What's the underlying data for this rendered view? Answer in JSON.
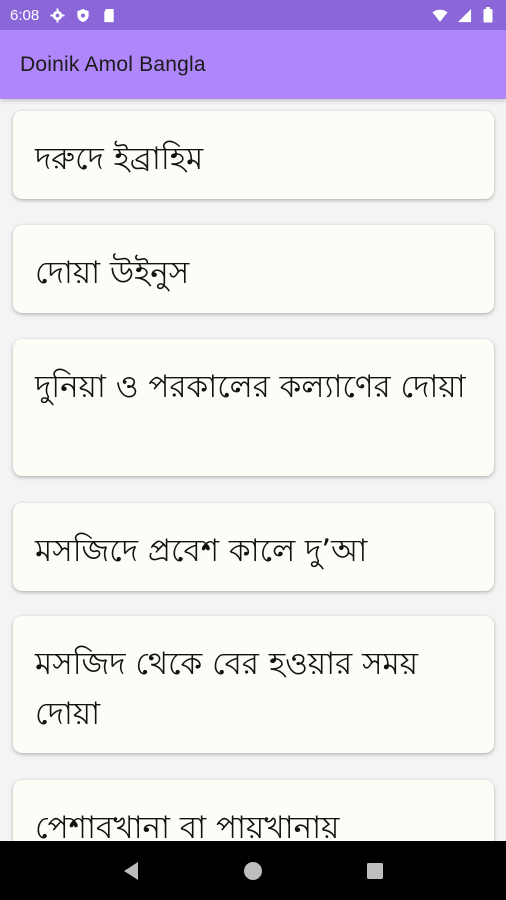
{
  "status_bar": {
    "time": "6:08",
    "left_icons": [
      "settings-gear-icon",
      "shield-icon",
      "sim-card-icon"
    ],
    "right_icons": [
      "wifi-icon",
      "cellular-signal-icon",
      "battery-icon"
    ]
  },
  "app_bar": {
    "title": "Doinik Amol Bangla"
  },
  "list": {
    "items": [
      {
        "label": "দরুদে ইব্রাহিম"
      },
      {
        "label": "দোয়া উইনুস"
      },
      {
        "label": "দুনিয়া ও পরকালের কল্যাণের দোয়া"
      },
      {
        "label": "মসজিদে প্রবেশ কালে দু’আ"
      },
      {
        "label": "মসজিদ থেকে বের হওয়ার সময় দোয়া"
      },
      {
        "label": "পেশাবখানা বা পায়খানায়"
      }
    ]
  },
  "nav_bar": {
    "buttons": [
      "back-icon",
      "home-icon",
      "recents-icon"
    ]
  },
  "colors": {
    "status_bar": "#8a66d9",
    "app_bar": "#b086fb",
    "background": "#f4f4f4",
    "card": "#fdfdf7",
    "nav_bar": "#000000"
  }
}
